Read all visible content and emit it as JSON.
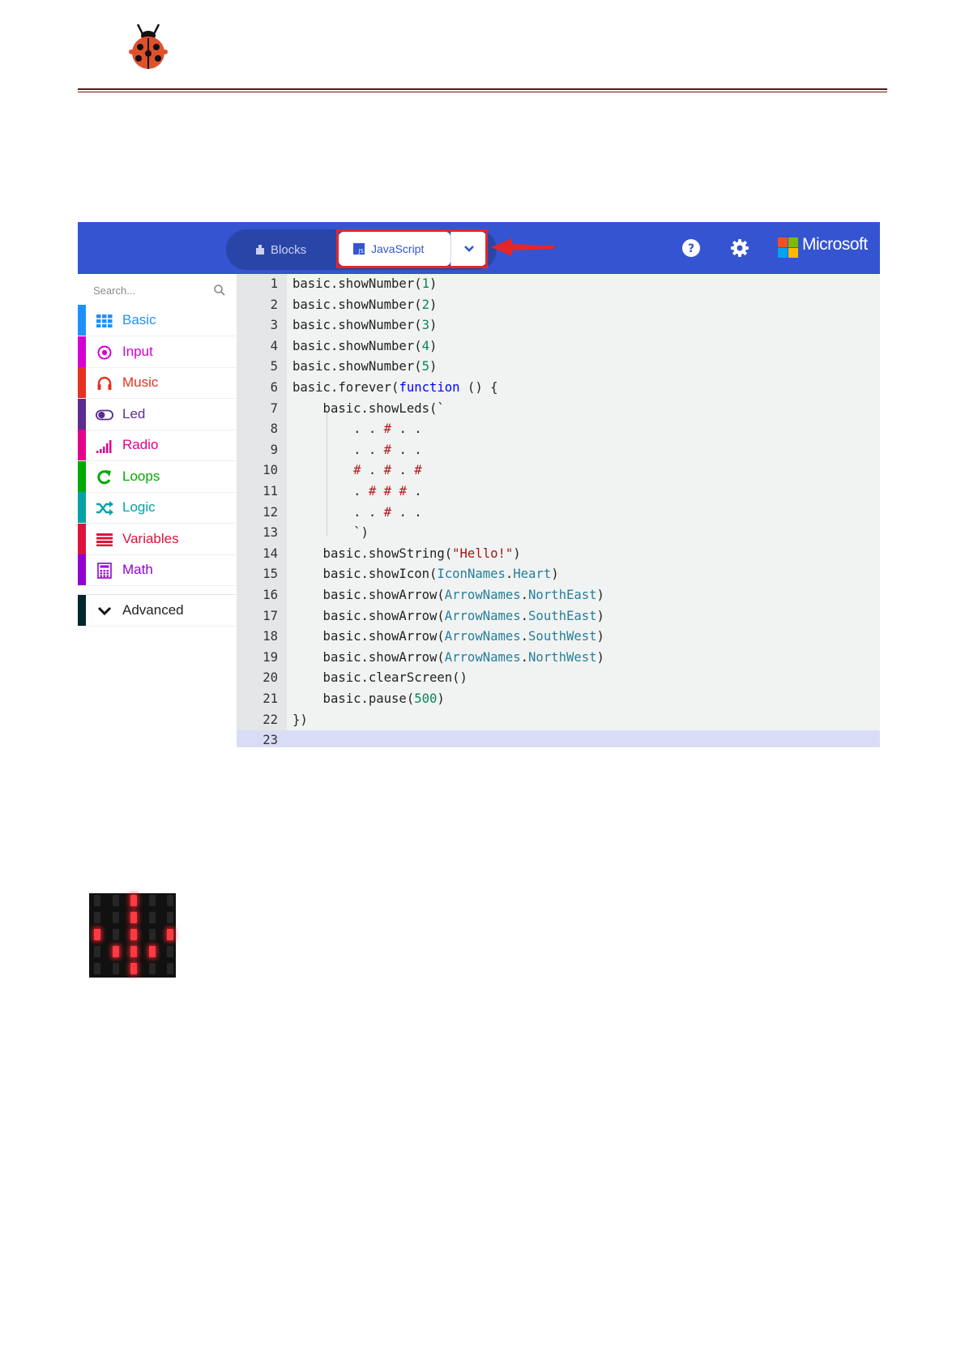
{
  "editor": {
    "tabs": {
      "blocks": "Blocks",
      "javascript": "JavaScript",
      "js_badge": "JS"
    },
    "brand": "Microsoft",
    "colors": {
      "topbar": "#3454d1",
      "highlight": "#e3262a"
    },
    "search": {
      "placeholder": "Search..."
    },
    "categories": [
      {
        "label": "Basic",
        "color": "#1e90ff",
        "icon": "grid-icon"
      },
      {
        "label": "Input",
        "color": "#d400d4",
        "icon": "target-icon"
      },
      {
        "label": "Music",
        "color": "#e63022",
        "icon": "headphones-icon"
      },
      {
        "label": "Led",
        "color": "#5c2d91",
        "icon": "toggle-icon"
      },
      {
        "label": "Radio",
        "color": "#e3008c",
        "icon": "signal-bars-icon"
      },
      {
        "label": "Loops",
        "color": "#00aa00",
        "icon": "loop-arrow-icon"
      },
      {
        "label": "Logic",
        "color": "#00a4a6",
        "icon": "shuffle-icon"
      },
      {
        "label": "Variables",
        "color": "#dc143c",
        "icon": "list-lines-icon"
      },
      {
        "label": "Math",
        "color": "#9400d3",
        "icon": "calculator-icon"
      },
      {
        "label": "Advanced",
        "color": "#00272b",
        "icon": "chevron-down-icon"
      }
    ],
    "code_lines": [
      "basic.showNumber(1)",
      "basic.showNumber(2)",
      "basic.showNumber(3)",
      "basic.showNumber(4)",
      "basic.showNumber(5)",
      "basic.forever(function () {",
      "    basic.showLeds(`",
      "        . . # . .",
      "        . . # . .",
      "        # . # . #",
      "        . # # # .",
      "        . . # . .",
      "        `)",
      "    basic.showString(\"Hello!\")",
      "    basic.showIcon(IconNames.Heart)",
      "    basic.showArrow(ArrowNames.NorthEast)",
      "    basic.showArrow(ArrowNames.SouthEast)",
      "    basic.showArrow(ArrowNames.SouthWest)",
      "    basic.showArrow(ArrowNames.NorthWest)",
      "    basic.clearScreen()",
      "    basic.pause(500)",
      "})",
      ""
    ]
  },
  "led_matrix": {
    "rows": [
      [
        0,
        0,
        1,
        0,
        0
      ],
      [
        0,
        0,
        1,
        0,
        0
      ],
      [
        1,
        0,
        1,
        0,
        1
      ],
      [
        0,
        1,
        1,
        1,
        0
      ],
      [
        0,
        0,
        1,
        0,
        0
      ]
    ]
  }
}
